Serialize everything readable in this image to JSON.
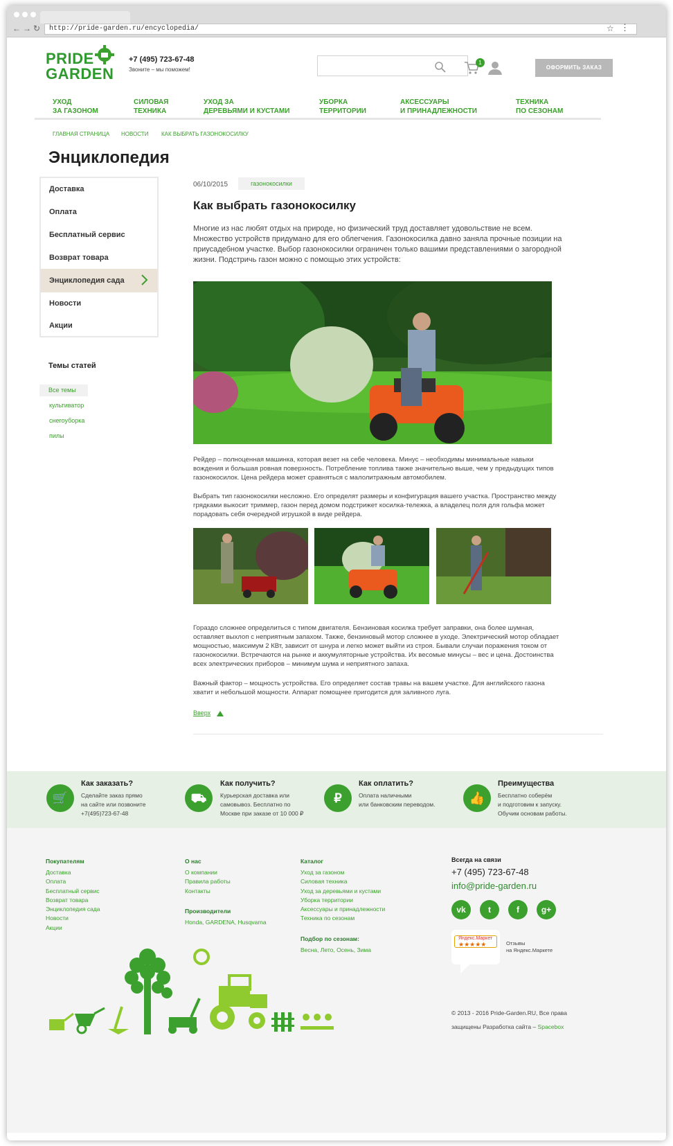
{
  "browser": {
    "url": "http://pride-garden.ru/encyclopedia/"
  },
  "header": {
    "logo_line1": "PRIDE",
    "logo_line2": "GARDEN",
    "phone": "+7 (495) 723-67-48",
    "phone_sub": "Звоните – мы поможем!",
    "cart_count": "1",
    "order_button": "ОФОРМИТЬ ЗАКАЗ"
  },
  "nav": [
    {
      "l1": "УХОД",
      "l2": "ЗА ГАЗОНОМ"
    },
    {
      "l1": "СИЛОВАЯ",
      "l2": "ТЕХНИКА"
    },
    {
      "l1": "УХОД ЗА",
      "l2": "ДЕРЕВЬЯМИ И КУСТАМИ"
    },
    {
      "l1": "УБОРКА",
      "l2": "ТЕРРИТОРИИ"
    },
    {
      "l1": "АКСЕССУАРЫ",
      "l2": "И ПРИНАДЛЕЖНОСТИ"
    },
    {
      "l1": "ТЕХНИКА",
      "l2": "ПО СЕЗОНАМ"
    }
  ],
  "breadcrumb": [
    "ГЛАВНАЯ СТРАНИЦА",
    "НОВОСТИ",
    "КАК ВЫБРАТЬ ГАЗОНОКОСИЛКУ"
  ],
  "page_title": "Энциклопедия",
  "sidebar": {
    "items": [
      "Доставка",
      "Оплата",
      "Бесплатный сервис",
      "Возврат товара",
      "Энциклопедия сада",
      "Новости",
      "Акции"
    ],
    "topics_title": "Темы статей",
    "topics": [
      "Все темы",
      "культиватор",
      "снегоуборка",
      "пилы"
    ]
  },
  "article": {
    "date": "06/10/2015",
    "tag": "газонокосилки",
    "title": "Как выбрать газонокосилку",
    "intro": [
      "Многие из нас любят отдых на природе, но физический труд доставляет удовольствие не всем.",
      "Множество устройств придумано для его облегчения. Газонокосилка давно заняла прочные позиции на",
      "приусадебном участке. Выбор газонокосилки ограничен только вашими представлениями о загородной",
      "жизни. Подстричь газон можно с помощью этих устройств:"
    ],
    "p1": [
      "Рейдер – полноценная машинка, которая везет на себе человека. Минус – необходимы минимальные навыки",
      "вождения и большая ровная поверхность. Потребление топлива также значительно выше, чем у предыдущих типов",
      "газонокосилок. Цена рейдера может сравняться с малолитражным автомобилем."
    ],
    "p2": [
      "Выбрать тип газонокосилки несложно. Его определят размеры и конфигурация вашего участка. Пространство между",
      "грядками выкосит триммер, газон перед домом подстрижет косилка-тележка, а владелец поля для гольфа может",
      "порадовать себя очередной игрушкой в виде рейдера."
    ],
    "p3": [
      "Гораздо сложнее определиться с типом двигателя. Бензиновая косилка требует заправки, она более шумная,",
      "оставляет выхлоп с неприятным запахом. Также, бензиновый мотор сложнее в уходе. Электрический мотор обладает",
      "мощностью, максимум 2 КВт, зависит от шнура и легко может выйти из строя. Бывали случаи поражения током от",
      "газонокосилки. Встречаются на рынке и аккумуляторные устройства. Их весомые минусы – вес и цена. Достоинства",
      "всех электрических приборов – минимум шума и неприятного запаха."
    ],
    "p4": [
      "Важный фактор – мощность устройства. Его определяет состав травы на вашем участке. Для английского газона",
      "хватит и небольшой мощности. Аппарат помощнее пригодится для заливного луга."
    ],
    "up_link": "Вверх"
  },
  "band": [
    {
      "title": "Как заказать?",
      "text": [
        "Сделайте заказ прямо",
        "на сайте или позвоните",
        "+7(495)723-67-48"
      ],
      "icon": "cart-icon"
    },
    {
      "title": "Как получить?",
      "text": [
        "Курьерская доставка или",
        "самовывоз. Бесплатно по",
        "Москве при заказе от 10 000 ₽"
      ],
      "icon": "truck-icon"
    },
    {
      "title": "Как оплатить?",
      "text": [
        "Оплата наличными",
        "или банковским переводом."
      ],
      "icon": "ruble-icon"
    },
    {
      "title": "Преимущества",
      "text": [
        "Бесплатно соберём",
        "и подготовим к запуску.",
        "Обучим основам работы."
      ],
      "icon": "thumb-up-icon"
    }
  ],
  "footer": {
    "buyers_title": "Покупателям",
    "buyers": [
      "Доставка",
      "Оплата",
      "Бесплатный сервис",
      "Возврат товара",
      "Энциклопедия сада",
      "Новости",
      "Акции"
    ],
    "about_title": "О нас",
    "about": [
      "О компании",
      "Правила работы",
      "Контакты"
    ],
    "makers_title": "Производители",
    "makers": "Honda, GARDENA, Husqvarna",
    "catalog_title": "Каталог",
    "catalog": [
      "Уход за газоном",
      "Силовая техника",
      "Уход за деревьями и кустами",
      "Уборка территории",
      "Аксессуары и принадлежности",
      "Техника по сезонам"
    ],
    "seasons_title": "Подбор по сезонам:",
    "seasons": "Весна, Лето, Осень, Зима",
    "contact_title": "Всегда на связи",
    "phone": "+7 (495) 723-67-48",
    "email": "info@pride-garden.ru",
    "socials": [
      "vk",
      "twitter",
      "facebook",
      "google-plus"
    ],
    "market_badge": "Яндекс.Маркет",
    "market_stars": "★★★★★",
    "market_text1": "Отзывы",
    "market_text2": "на Яндекс.Маркете",
    "copyright1": "© 2013 - 2016 Pride-Garden.RU, Все права",
    "copyright2": "защищены Разработка сайта –",
    "dev": "Spacebox"
  },
  "colors": {
    "accent": "#3ba02e",
    "active_bg": "#ece3d8",
    "band_bg": "#e6f0e4"
  }
}
